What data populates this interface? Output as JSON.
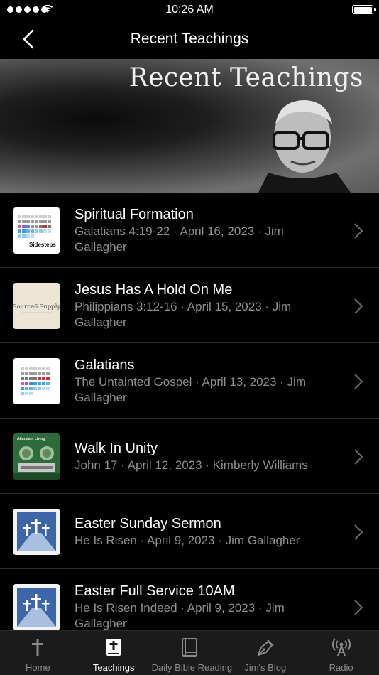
{
  "status": {
    "time": "10:26 AM"
  },
  "nav": {
    "title": "Recent Teachings"
  },
  "banner": {
    "text": "Recent Teachings"
  },
  "items": [
    {
      "title": "Spiritual Formation",
      "subtitle": "Galatians 4:19-22 · April 16, 2023 · Jim Gallagher",
      "thumb_label": "Sidesteps"
    },
    {
      "title": "Jesus Has A Hold On Me",
      "subtitle": "Philippians 3:12-16 · April 15, 2023 · Jim Gallagher",
      "thumb_label": "Source&Supply"
    },
    {
      "title": "Galatians",
      "subtitle": "The Untainted Gospel · April 13, 2023 · Jim Gallagher"
    },
    {
      "title": "Walk In Unity",
      "subtitle": "John 17 · April 12, 2023 · Kimberly Williams",
      "thumb_label": "Abundant Living"
    },
    {
      "title": "Easter Sunday Sermon",
      "subtitle": "He Is Risen · April 9, 2023 · Jim Gallagher"
    },
    {
      "title": "Easter Full Service 10AM",
      "subtitle": "He Is Risen Indeed · April 9, 2023 · Jim Gallagher"
    }
  ],
  "tabs": [
    {
      "label": "Home",
      "icon": "cross-icon",
      "active": false
    },
    {
      "label": "Teachings",
      "icon": "bible-icon",
      "active": true
    },
    {
      "label": "Daily Bible Reading",
      "icon": "book-icon",
      "active": false
    },
    {
      "label": "Jim's Blog",
      "icon": "pen-icon",
      "active": false
    },
    {
      "label": "Radio",
      "icon": "radio-icon",
      "active": false
    }
  ]
}
